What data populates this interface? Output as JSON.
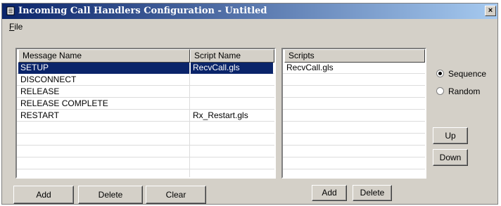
{
  "window": {
    "title": "Incoming Call Handlers Configuration - Untitled",
    "close_glyph": "×"
  },
  "menu": {
    "file_mnemonic": "F",
    "file_rest": "ile"
  },
  "handlers_table": {
    "columns": [
      "Message Name",
      "Script Name"
    ],
    "rows": [
      {
        "message": "SETUP",
        "script": "RecvCall.gls",
        "selected": true
      },
      {
        "message": "DISCONNECT",
        "script": ""
      },
      {
        "message": "RELEASE",
        "script": ""
      },
      {
        "message": "RELEASE COMPLETE",
        "script": ""
      },
      {
        "message": "RESTART",
        "script": "Rx_Restart.gls"
      },
      {
        "message": "",
        "script": ""
      },
      {
        "message": "",
        "script": ""
      },
      {
        "message": "",
        "script": ""
      },
      {
        "message": "",
        "script": ""
      }
    ]
  },
  "scripts_list": {
    "header": "Scripts",
    "items": [
      "RecvCall.gls",
      "",
      "",
      "",
      "",
      "",
      "",
      "",
      ""
    ]
  },
  "order": {
    "options": [
      {
        "label": "Sequence",
        "selected": true
      },
      {
        "label": "Random",
        "selected": false
      }
    ]
  },
  "buttons": {
    "up": "Up",
    "down": "Down",
    "add": "Add",
    "delete": "Delete",
    "clear": "Clear",
    "scripts_add": "Add",
    "scripts_delete": "Delete"
  },
  "colors": {
    "titlebar_start": "#0a246a",
    "titlebar_end": "#a6caf0",
    "selection": "#0a246a",
    "face": "#d4d0c8"
  }
}
